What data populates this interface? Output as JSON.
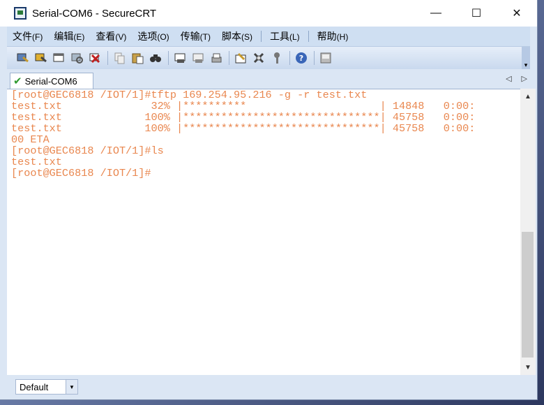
{
  "window": {
    "title": "Serial-COM6 - SecureCRT"
  },
  "window_controls": {
    "minimize": "—",
    "maximize": "☐",
    "close": "✕"
  },
  "menu": [
    {
      "label": "文件",
      "accel": "(F)"
    },
    {
      "label": "编辑",
      "accel": "(E)"
    },
    {
      "label": "查看",
      "accel": "(V)"
    },
    {
      "label": "选项",
      "accel": "(O)"
    },
    {
      "label": "传输",
      "accel": "(T)"
    },
    {
      "label": "脚本",
      "accel": "(S)"
    },
    {
      "label": "工具",
      "accel": "(L)"
    },
    {
      "label": "帮助",
      "accel": "(H)"
    }
  ],
  "toolbar_icons": [
    "connect-icon",
    "quick-connect-icon",
    "connect-tab-icon",
    "reconnect-icon",
    "disconnect-icon",
    "copy-icon",
    "paste-icon",
    "find-icon",
    "print-screen-icon",
    "print-selection-icon",
    "print-icon",
    "session-options-icon",
    "global-options-icon",
    "keymap-icon",
    "help-icon",
    "sftp-icon"
  ],
  "tab": {
    "label": "Serial-COM6",
    "nav_left": "◁",
    "nav_right": "▷"
  },
  "terminal": {
    "lines": [
      "[root@GEC6818 /IOT/1]#tftp 169.254.95.216 -g -r test.txt",
      "test.txt              32% |**********                     | 14848   0:00:",
      "test.txt             100% |*******************************| 45758   0:00:",
      "test.txt             100% |*******************************| 45758   0:00:",
      "00 ETA",
      "[root@GEC6818 /IOT/1]#ls",
      "test.txt",
      "[root@GEC6818 /IOT/1]#"
    ]
  },
  "scrollbar": {
    "up": "▲",
    "down": "▼"
  },
  "statusbar": {
    "session_value": "Default",
    "dropdown": "▼"
  },
  "colors": {
    "terminal_text": "#e9874f",
    "chrome": "#dbe6f4"
  }
}
